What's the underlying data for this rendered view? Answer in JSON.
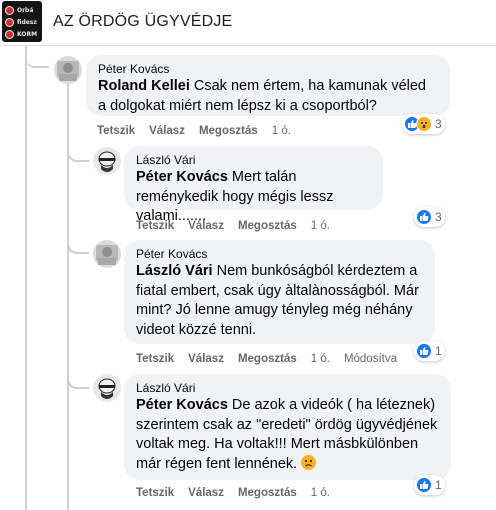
{
  "header": {
    "title": "AZ ÖRDÖG ÜGYVÉDJE",
    "thumb_lines": [
      "Orbá",
      "fidesz",
      "KORM"
    ]
  },
  "comments": [
    {
      "author": "Péter Kovács",
      "mention": "Roland Kellei",
      "text": "Csak nem értem, ha kamunak véled a dolgokat miért nem lépsz ki a csoportból?",
      "actions": {
        "like": "Tetszik",
        "reply": "Válasz",
        "share": "Megosztás",
        "time": "1 ó."
      },
      "reactions": {
        "types": [
          "like-icon",
          "wow-icon"
        ],
        "count": "3"
      }
    },
    {
      "author": "László Vári",
      "mention": "Péter Kovács",
      "text": "Mert talán reménykedik hogy mégis lessz valami.......",
      "actions": {
        "like": "Tetszik",
        "reply": "Válasz",
        "share": "Megosztás",
        "time": "1 ó."
      },
      "reactions": {
        "types": [
          "like-icon"
        ],
        "count": "3"
      }
    },
    {
      "author": "Péter Kovács",
      "mention": "László Vári",
      "text": "Nem bunkóságból kérdeztem a fiatal embert, csak úgy àltalànosságból. Már mint? Jó lenne amugy tényleg még néhány videot közzé tenni.",
      "actions": {
        "like": "Tetszik",
        "reply": "Válasz",
        "share": "Megosztás",
        "time": "1 ó.",
        "edited": "Módosítva"
      },
      "reactions": {
        "types": [
          "like-icon"
        ],
        "count": "1"
      }
    },
    {
      "author": "László Vári",
      "mention": "Péter Kovács",
      "text": "De azok a videók ( ha léteznek) szerintem csak az \"eredeti\" ördög ügyvédjének voltak meg. Ha voltak!!! Mert másbkülönben már régen fent lennének.",
      "emoji": "frowning-face-emoji",
      "actions": {
        "like": "Tetszik",
        "reply": "Válasz",
        "share": "Megosztás",
        "time": "1 ó."
      },
      "reactions": {
        "types": [
          "like-icon"
        ],
        "count": "1"
      }
    }
  ],
  "colors": {
    "bubble": "#f0f2f5",
    "like_blue": "#1877f2",
    "wow_yellow": "#f7b125",
    "meta_gray": "#65676b",
    "thread_line": "#ced0d4"
  }
}
